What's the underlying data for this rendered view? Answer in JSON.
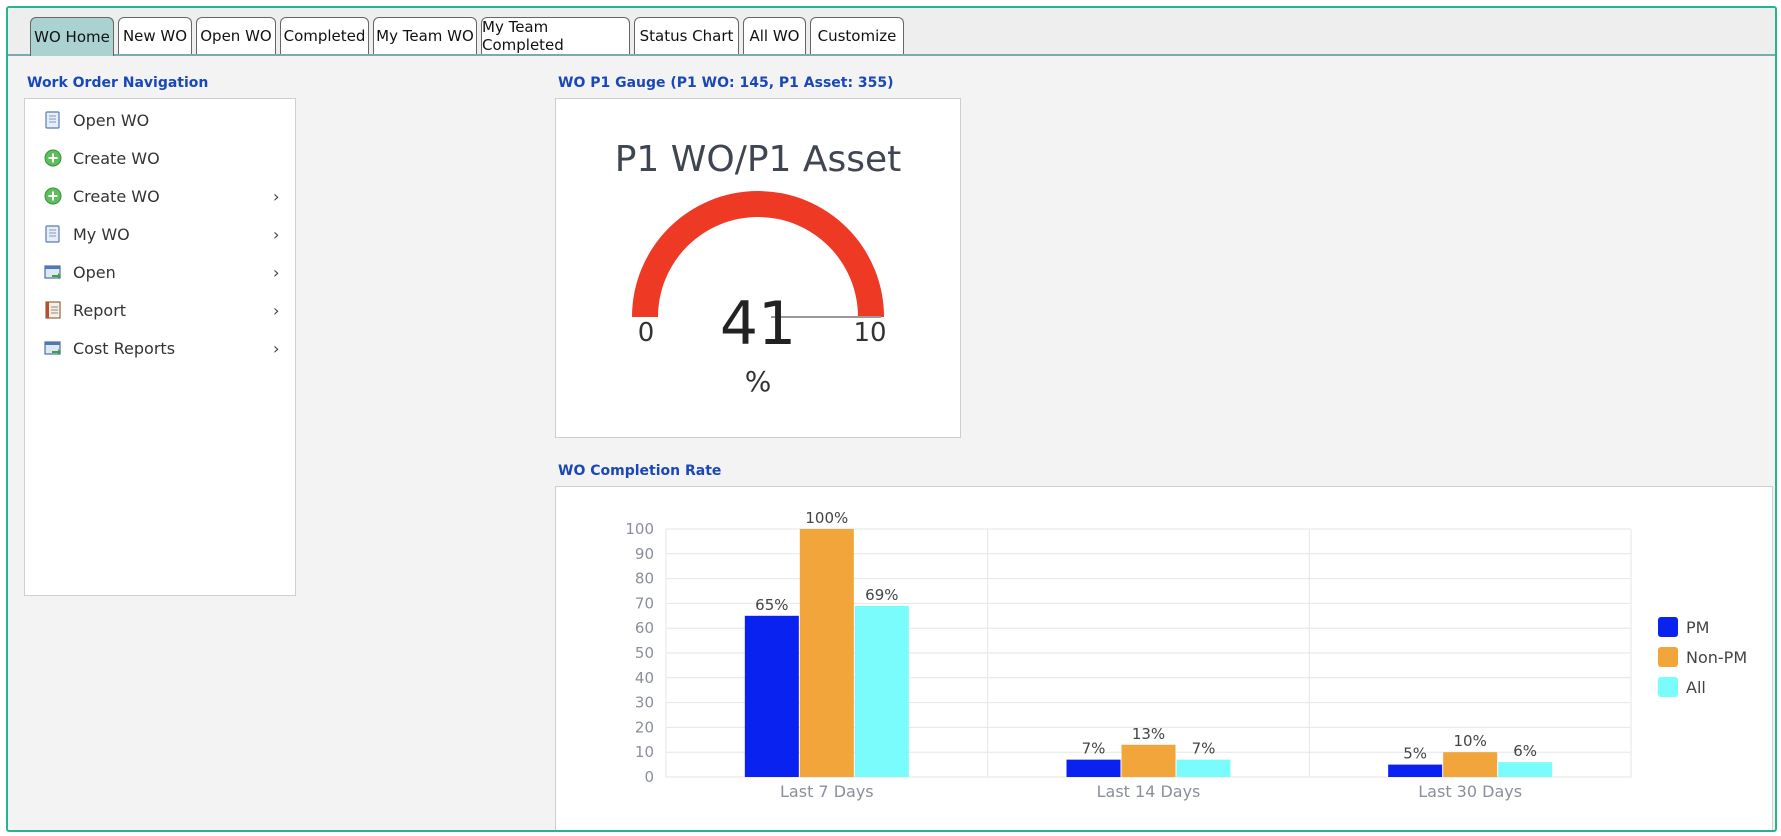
{
  "tabs": [
    {
      "label": "WO Home",
      "active": true
    },
    {
      "label": "New WO"
    },
    {
      "label": "Open WO"
    },
    {
      "label": "Completed"
    },
    {
      "label": "My Team WO"
    },
    {
      "label": "My Team Completed"
    },
    {
      "label": "Status Chart"
    },
    {
      "label": "All WO"
    },
    {
      "label": "Customize"
    }
  ],
  "nav": {
    "title": "Work Order Navigation",
    "items": [
      {
        "label": "Open WO",
        "icon": "document-icon",
        "submenu": false
      },
      {
        "label": "Create WO",
        "icon": "plus-circle-icon",
        "submenu": false
      },
      {
        "label": "Create WO",
        "icon": "plus-circle-icon",
        "submenu": true
      },
      {
        "label": "My WO",
        "icon": "document-icon",
        "submenu": true
      },
      {
        "label": "Open",
        "icon": "open-window-icon",
        "submenu": true
      },
      {
        "label": "Report",
        "icon": "report-icon",
        "submenu": true
      },
      {
        "label": "Cost Reports",
        "icon": "open-window-icon",
        "submenu": true
      }
    ],
    "chevron": "›"
  },
  "gauge": {
    "section_title": "WO P1 Gauge (P1 WO: 145, P1 Asset: 355)",
    "title": "P1 WO/P1 Asset",
    "value_text": "41",
    "unit": "%",
    "min_label": "0",
    "max_label": "10",
    "arc_color": "#ee3a24"
  },
  "completion": {
    "section_title": "WO Completion Rate"
  },
  "chart_data": {
    "type": "bar",
    "categories": [
      "Last 7 Days",
      "Last 14 Days",
      "Last 30 Days"
    ],
    "series": [
      {
        "name": "PM",
        "values": [
          65,
          7,
          5
        ],
        "labels": [
          "65%",
          "7%",
          "5%"
        ],
        "color": "#0a22f0"
      },
      {
        "name": "Non-PM",
        "values": [
          100,
          13,
          10
        ],
        "labels": [
          "100%",
          "13%",
          "10%"
        ],
        "color": "#f2a53a"
      },
      {
        "name": "All",
        "values": [
          69,
          7,
          6
        ],
        "labels": [
          "69%",
          "7%",
          "6%"
        ],
        "color": "#7afcfc"
      }
    ],
    "yticks": [
      "0",
      "10",
      "20",
      "30",
      "40",
      "50",
      "60",
      "70",
      "80",
      "90",
      "100"
    ],
    "ylim": [
      0,
      100
    ],
    "grid": true,
    "legend": "right"
  }
}
